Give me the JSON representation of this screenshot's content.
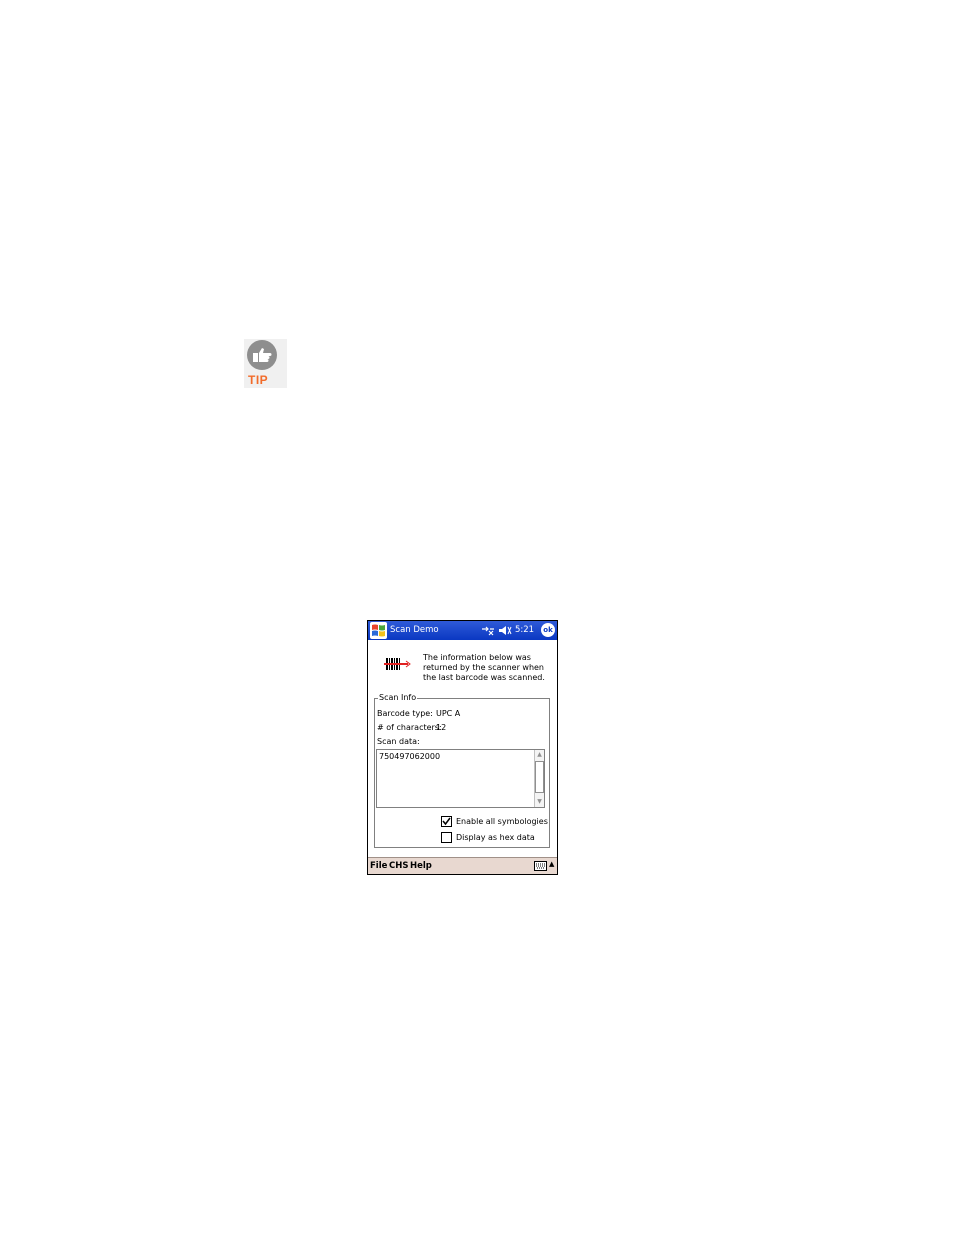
{
  "tip": {
    "label": "TIP",
    "icon": "pointing-hand-icon"
  },
  "window": {
    "start_icon": "windows-flag-icon",
    "title": "Scan Demo",
    "connectivity_icon": "connectivity-icon",
    "volume_icon": "speaker-muted-icon",
    "time": "5:21",
    "ok_label": "ok"
  },
  "header": {
    "icon": "barcode-scanner-icon",
    "line1": "The information below was",
    "line2": "returned by the scanner when",
    "line3": "the last barcode was scanned."
  },
  "scan_info": {
    "legend": "Scan Info",
    "barcode_type_label": "Barcode type:",
    "barcode_type_value": "UPC A",
    "char_count_label": "# of characters:",
    "char_count_value": "12",
    "scan_data_label": "Scan data:",
    "scan_data_value": "750497062000"
  },
  "options": {
    "enable_all_label": "Enable all symbologies",
    "enable_all_checked": true,
    "hex_label": "Display as hex data",
    "hex_checked": false
  },
  "menu": {
    "items": [
      "File",
      "CHS",
      "Help"
    ],
    "keyboard_icon": "keyboard-icon",
    "arrow": "▲"
  }
}
